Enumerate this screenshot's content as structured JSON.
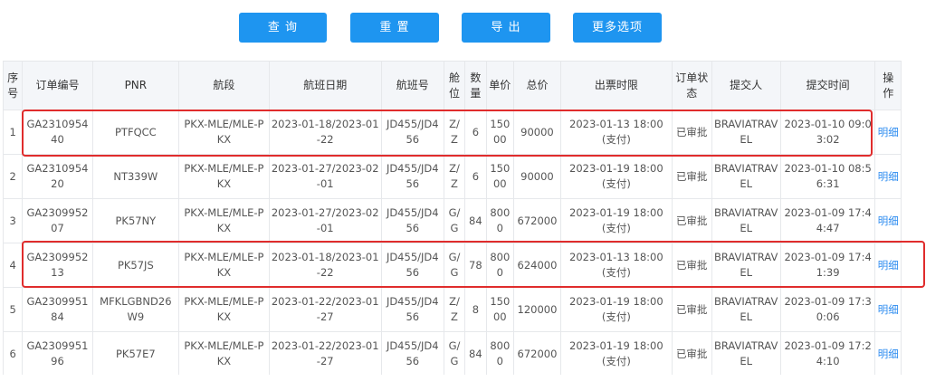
{
  "toolbar": {
    "query_label": "查 询",
    "reset_label": "重 置",
    "export_label": "导 出",
    "more_label": "更多选项"
  },
  "table": {
    "headers": [
      "序号",
      "订单编号",
      "PNR",
      "航段",
      "航班日期",
      "航班号",
      "舱位",
      "数量",
      "单价",
      "总价",
      "出票时限",
      "订单状态",
      "提交人",
      "提交时间",
      "操作"
    ],
    "rows": [
      [
        "1",
        "GA231095440",
        "PTFQCC",
        "PKX-MLE/MLE-PKX",
        "2023-01-18/2023-01-22",
        "JD455/JD456",
        "Z/Z",
        "6",
        "15000",
        "90000",
        "2023-01-13 18:00(支付)",
        "已审批",
        "BRAVIATRAVEL",
        "2023-01-10 09:03:02",
        "明细"
      ],
      [
        "2",
        "GA231095420",
        "NT339W",
        "PKX-MLE/MLE-PKX",
        "2023-01-27/2023-02-01",
        "JD455/JD456",
        "Z/Z",
        "6",
        "15000",
        "90000",
        "2023-01-19 18:00(支付)",
        "已审批",
        "BRAVIATRAVEL",
        "2023-01-10 08:56:31",
        "明细"
      ],
      [
        "3",
        "GA230995207",
        "PK57NY",
        "PKX-MLE/MLE-PKX",
        "2023-01-27/2023-02-01",
        "JD455/JD456",
        "G/G",
        "84",
        "8000",
        "672000",
        "2023-01-19 18:00(支付)",
        "已审批",
        "BRAVIATRAVEL",
        "2023-01-09 17:44:47",
        "明细"
      ],
      [
        "4",
        "GA230995213",
        "PK57JS",
        "PKX-MLE/MLE-PKX",
        "2023-01-18/2023-01-22",
        "JD455/JD456",
        "G/G",
        "78",
        "8000",
        "624000",
        "2023-01-13 18:00(支付)",
        "已审批",
        "BRAVIATRAVEL",
        "2023-01-09 17:41:39",
        "明细"
      ],
      [
        "5",
        "GA230995184",
        "MFKLGBND26W9",
        "PKX-MLE/MLE-PKX",
        "2023-01-22/2023-01-27",
        "JD455/JD456",
        "Z/Z",
        "8",
        "15000",
        "120000",
        "2023-01-19 18:00(支付)",
        "已审批",
        "BRAVIATRAVEL",
        "2023-01-09 17:30:06",
        "明细"
      ],
      [
        "6",
        "GA230995196",
        "PK57E7",
        "PKX-MLE/MLE-PKX",
        "2023-01-22/2023-01-27",
        "JD455/JD456",
        "G/G",
        "84",
        "8000",
        "672000",
        "2023-01-19 18:00(支付)",
        "已审批",
        "BRAVIATRAVEL",
        "2023-01-09 17:24:10",
        "明细"
      ]
    ]
  },
  "colors": {
    "accent": "#1e95f0",
    "link": "#2d8cf0",
    "highlight": "#e02c2c",
    "header_bg": "#f4f6f9"
  }
}
